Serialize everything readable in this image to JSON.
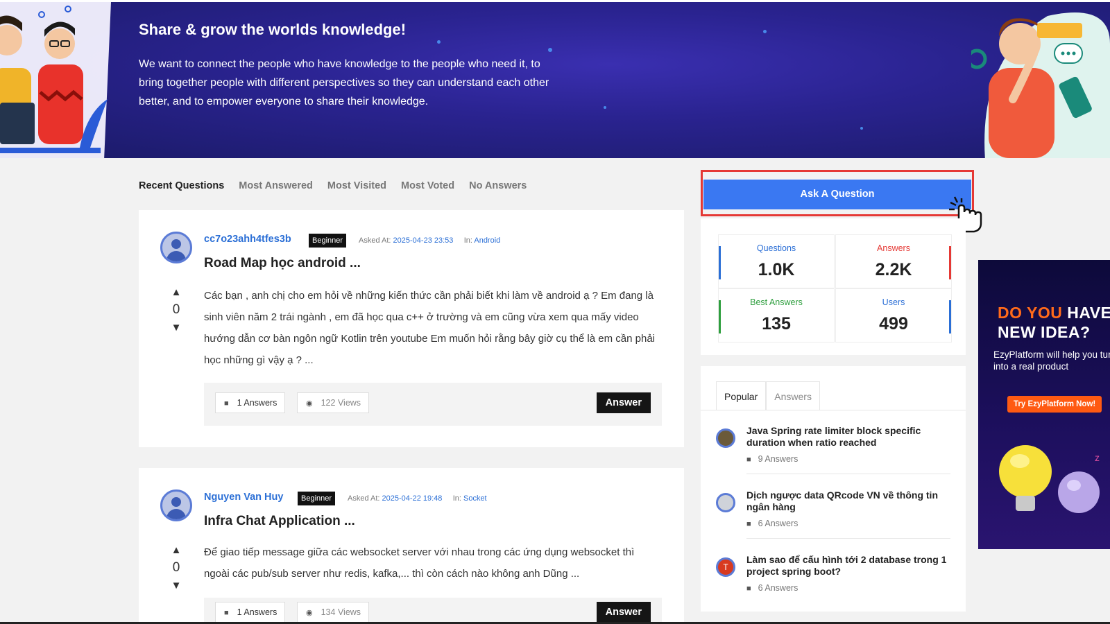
{
  "hero": {
    "title": "Share & grow the worlds knowledge!",
    "description": "We want to connect the people who have knowledge to the people who need it, to bring together people with different perspectives so they can understand each other better, and to empower everyone to share their knowledge."
  },
  "tabs": [
    "Recent Questions",
    "Most Answered",
    "Most Visited",
    "Most Voted",
    "No Answers"
  ],
  "questions": [
    {
      "user": "cc7o23ahh4tfes3b",
      "badge": "Beginner",
      "asked_label": "Asked At:",
      "asked_at": "2025-04-23 23:53",
      "in_label": "In:",
      "category": "Android",
      "title": "Road Map học android ...",
      "votes": "0",
      "excerpt": "Các bạn , anh chị cho em hỏi về những kiến thức cần phải biết khi làm về android ạ ? Em đang là sinh viên năm 2 trái ngành , em đã học qua c++ ở trường và em cũng vừa xem qua mấy video hướng dẫn cơ bàn ngôn ngữ Kotlin trên youtube Em muốn hỏi rằng bây giờ cụ thể là em cần phải học những gì vậy ạ ? ...",
      "answers": "1 Answers",
      "views": "122 Views",
      "answer_btn": "Answer"
    },
    {
      "user": "Nguyen Van Huy",
      "badge": "Beginner",
      "asked_label": "Asked At:",
      "asked_at": "2025-04-22 19:48",
      "in_label": "In:",
      "category": "Socket",
      "title": "Infra Chat Application ...",
      "votes": "0",
      "excerpt": "Để giao tiếp message giữa các websocket server với nhau trong các ứng dụng websocket thì ngoài các pub/sub server như redis, kafka,... thì còn cách nào không anh Dũng ...",
      "answers": "1 Answers",
      "views": "134 Views",
      "answer_btn": "Answer"
    }
  ],
  "sidebar": {
    "ask_button": "Ask A Question",
    "stats": [
      {
        "label": "Questions",
        "value": "1.0K",
        "color": "#2b6fd6"
      },
      {
        "label": "Answers",
        "value": "2.2K",
        "color": "#e53935"
      },
      {
        "label": "Best Answers",
        "value": "135",
        "color": "#2e9e3e"
      },
      {
        "label": "Users",
        "value": "499",
        "color": "#2b6fd6"
      }
    ],
    "widget_tabs": [
      "Popular",
      "Answers"
    ],
    "popular": [
      {
        "title": "Java Spring rate limiter block specific duration when ratio reached",
        "answers": "9 Answers"
      },
      {
        "title": "Dịch ngược data QRcode VN về thông tin ngân hàng",
        "answers": "6 Answers"
      },
      {
        "title": "Làm sao để cấu hình tới 2 database trong 1 project spring boot?",
        "answers": "6 Answers",
        "avatar_letter": "T"
      }
    ]
  },
  "ad": {
    "line1_a": "DO YOU",
    "line1_b": "HAVE A",
    "line2": "NEW IDEA?",
    "sub": "EzyPlatform will help you turn it into a real product",
    "cta": "Try EzyPlatform Now!"
  },
  "colors": {
    "accent": "#3a78f2",
    "link": "#2b6fd6",
    "highlight": "#e53935"
  }
}
